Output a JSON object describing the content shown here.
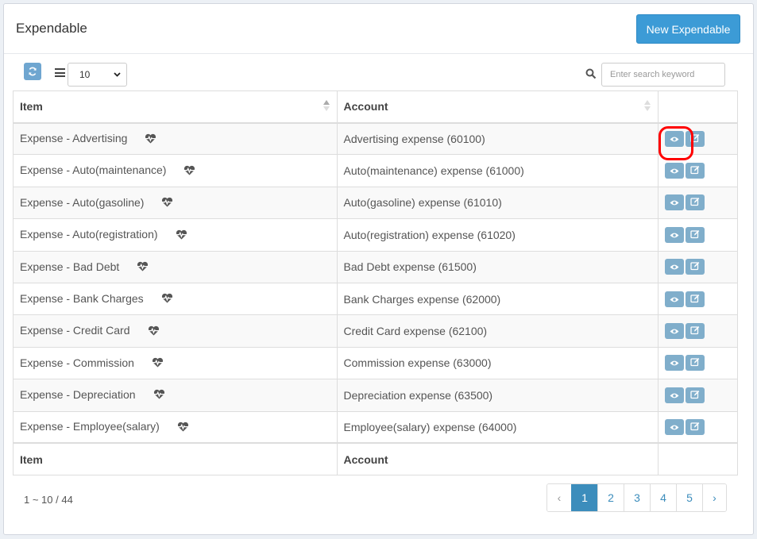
{
  "header": {
    "title": "Expendable",
    "new_button": "New Expendable"
  },
  "toolbar": {
    "page_size": "10",
    "search_placeholder": "Enter search keyword"
  },
  "table": {
    "columns": [
      "Item",
      "Account"
    ],
    "rows": [
      {
        "item": "Expense - Advertising",
        "account": "Advertising expense (60100)"
      },
      {
        "item": "Expense - Auto(maintenance)",
        "account": "Auto(maintenance) expense (61000)"
      },
      {
        "item": "Expense - Auto(gasoline)",
        "account": "Auto(gasoline) expense (61010)"
      },
      {
        "item": "Expense - Auto(registration)",
        "account": "Auto(registration) expense (61020)"
      },
      {
        "item": "Expense - Bad Debt",
        "account": "Bad Debt expense (61500)"
      },
      {
        "item": "Expense - Bank Charges",
        "account": "Bank Charges expense (62000)"
      },
      {
        "item": "Expense - Credit Card",
        "account": "Credit Card expense (62100)"
      },
      {
        "item": "Expense - Commission",
        "account": "Commission expense (63000)"
      },
      {
        "item": "Expense - Depreciation",
        "account": "Depreciation expense (63500)"
      },
      {
        "item": "Expense - Employee(salary)",
        "account": "Employee(salary) expense (64000)"
      }
    ],
    "footer": [
      "Item",
      "Account"
    ]
  },
  "summary": "1 ~ 10 / 44",
  "pagination": {
    "prev": "‹",
    "pages": [
      "1",
      "2",
      "3",
      "4",
      "5"
    ],
    "active": "1",
    "next": "›"
  },
  "icons": {
    "row_badge": "heartbeat-icon",
    "view": "eye-icon",
    "edit": "edit-icon",
    "refresh": "refresh-icon",
    "list": "list-icon",
    "search": "search-icon"
  },
  "colors": {
    "primary": "#3c9bd6",
    "action_button": "#80aecb",
    "highlight": "#ff0000"
  }
}
